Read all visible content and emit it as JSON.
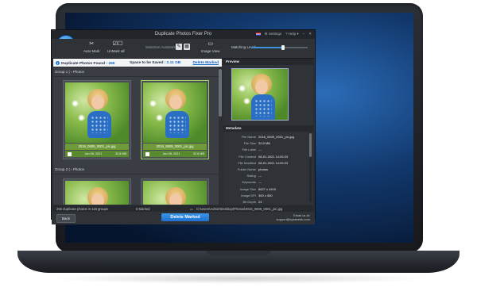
{
  "app": {
    "title": "Duplicate Photos Fixer Pro",
    "settings_label": "⚙ Settings",
    "help_label": "? Help ▾"
  },
  "toolbar": {
    "auto_mark": "Auto Mark",
    "unmark_all": "UnMark all",
    "selection_assistant": "Selection Assistant",
    "image_view": "Image View",
    "matching_level": "Matching Level:",
    "matching_level_value": 0.55
  },
  "summary": {
    "found_label": "Duplicate Photos Found :",
    "found_count": "266",
    "space_label": "Space to be Saved :",
    "space_value": "2.11 GB",
    "delete_marked_link": "Delete Marked"
  },
  "groups": [
    {
      "label": "Group 1 |",
      "sub": "Photos",
      "items": [
        {
          "name": "2016_0609_0001_pic.jpg",
          "date": "Jan 08, 2021",
          "size": "32.8 MB",
          "selected": false
        },
        {
          "name": "2016_0609_0001_pic.jpg",
          "date": "Jan 08, 2021",
          "size": "32.8 MB",
          "selected": true
        }
      ]
    },
    {
      "label": "Group 2 |",
      "sub": "Photos",
      "items": []
    }
  ],
  "preview": {
    "header": "Preview"
  },
  "metadata": {
    "header": "Metadata",
    "rows": [
      {
        "key": "File Name",
        "value": "2016_0609_0001_pic.jpg"
      },
      {
        "key": "File Size",
        "value": "32.8 MB"
      },
      {
        "key": "File Label",
        "value": "---"
      },
      {
        "key": "File Created",
        "value": "08-01-2021 14:09:23"
      },
      {
        "key": "File Modified",
        "value": "08-01-2021 14:09:23"
      },
      {
        "key": "Folder Name",
        "value": "photos"
      },
      {
        "key": "Rating",
        "value": "---"
      },
      {
        "key": "Keywords",
        "value": "---"
      },
      {
        "key": "Image Size",
        "value": "6627 x 4419"
      },
      {
        "key": "Image DPI",
        "value": "300 x 300"
      },
      {
        "key": "Bit Depth",
        "value": "24"
      },
      {
        "key": "Orientation",
        "value": "---"
      }
    ]
  },
  "status": {
    "groups_text": "266 duplicate photos in 118 groups",
    "marked_text": "0 Marked",
    "path_text": "C:\\Users\\Admin\\Desktop\\Photos\\2016_0609_0001_pic.jpg"
  },
  "bottom": {
    "back_label": "Back",
    "delete_label": "Delete Marked",
    "email_label": "Email us at:",
    "email_value": "support@systweak.com"
  }
}
